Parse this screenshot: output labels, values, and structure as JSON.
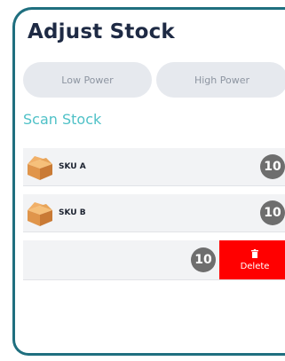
{
  "page": {
    "title": "Adjust Stock"
  },
  "power": {
    "low_label": "Low Power",
    "high_label": "High Power"
  },
  "scan": {
    "section_title": "Scan Stock"
  },
  "stock_items": [
    {
      "sku": "SKU A",
      "qty": "10",
      "icon": "box-icon"
    },
    {
      "sku": "SKU B",
      "qty": "10",
      "icon": "box-icon"
    }
  ],
  "swiped_item": {
    "qty": "10",
    "delete_label": "Delete",
    "delete_icon": "trash-icon"
  },
  "colors": {
    "accent": "#4fc1c7",
    "frame": "#1f6f7f",
    "delete": "#ff0000",
    "badge": "#6e6e6e"
  }
}
